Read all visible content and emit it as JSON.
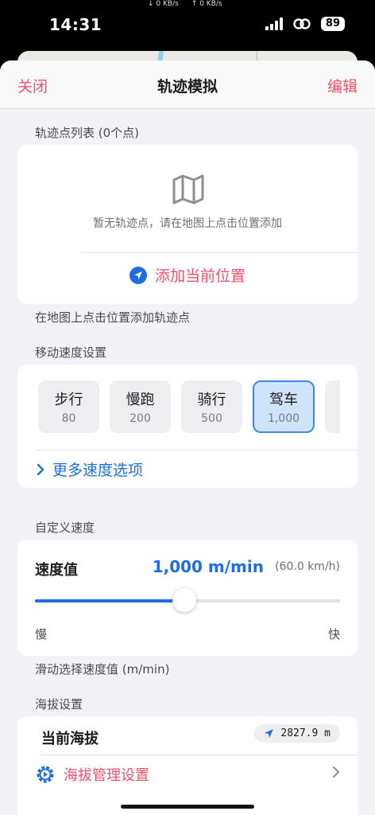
{
  "status_bar": {
    "time": "14:31",
    "download_speed": "↓ 0 KB/s",
    "upload_speed": "↑ 0 KB/s",
    "battery": "89",
    "icons": [
      "cellular-signal-icon",
      "link-icon",
      "battery-icon"
    ]
  },
  "nav": {
    "close_label": "关闭",
    "title": "轨迹模拟",
    "edit_label": "编辑"
  },
  "track_list": {
    "header": "轨迹点列表 (0个点)",
    "empty_icon": "map-icon",
    "empty_text": "暂无轨迹点，请在地图上点击位置添加",
    "add_current_label": "添加当前位置",
    "footer": "在地图上点击位置添加轨迹点"
  },
  "speed_settings": {
    "header": "移动速度设置",
    "presets": [
      {
        "name": "步行",
        "value": "80",
        "selected": false
      },
      {
        "name": "慢跑",
        "value": "200",
        "selected": false
      },
      {
        "name": "骑行",
        "value": "500",
        "selected": false
      },
      {
        "name": "驾车",
        "value": "1,000",
        "selected": true
      }
    ],
    "more_label": "更多速度选项"
  },
  "custom_speed": {
    "header": "自定义速度",
    "label": "速度值",
    "value": "1,000 m/min",
    "kmh": "(60.0 km/h)",
    "slider_fraction": 0.49,
    "min_label": "慢",
    "max_label": "快",
    "footer": "滑动选择速度值 (m/min)"
  },
  "altitude": {
    "header": "海拔设置",
    "current_label": "当前海拔",
    "current_value": "2827.9 m",
    "manage_label": "海拔管理设置"
  },
  "colors": {
    "accent_red": "#f2506a",
    "accent_blue": "#1b6fe0",
    "selected_bg": "#cfe3fb"
  }
}
